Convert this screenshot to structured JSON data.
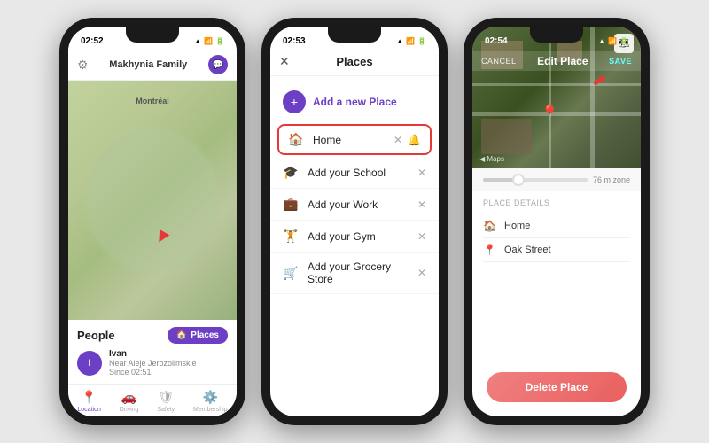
{
  "phone1": {
    "statusBar": {
      "time": "02:52",
      "icons": "▲ ▼ 📶 🔋"
    },
    "header": {
      "familyName": "Makhynia Family"
    },
    "mapLabel": "Montréal",
    "bottomPanel": {
      "peopleLabel": "People",
      "placesBtn": "Places",
      "person": {
        "initial": "I",
        "name": "Ivan",
        "location": "Near Aleje Jerozolimskie",
        "since": "Since 02:51"
      }
    },
    "nav": [
      {
        "label": "Location",
        "icon": "📍",
        "active": true
      },
      {
        "label": "Driving",
        "icon": "🚗",
        "active": false
      },
      {
        "label": "Safety",
        "icon": "🛡",
        "active": false
      },
      {
        "label": "Membership",
        "icon": "⚙️",
        "active": false
      }
    ]
  },
  "phone2": {
    "statusBar": {
      "time": "02:53"
    },
    "header": {
      "title": "Places"
    },
    "addNew": "Add a new Place",
    "places": [
      {
        "icon": "🏠",
        "name": "Home",
        "highlighted": true,
        "hasX": true,
        "hasBell": true
      },
      {
        "icon": "🎓",
        "name": "Add your School",
        "highlighted": false,
        "hasX": true,
        "hasBell": false
      },
      {
        "icon": "💼",
        "name": "Add your Work",
        "highlighted": false,
        "hasX": true,
        "hasBell": false
      },
      {
        "icon": "🏋",
        "name": "Add your Gym",
        "highlighted": false,
        "hasX": true,
        "hasBell": false
      },
      {
        "icon": "🛒",
        "name": "Add your Grocery Store",
        "highlighted": false,
        "hasX": true,
        "hasBell": false
      }
    ]
  },
  "phone3": {
    "statusBar": {
      "time": "02:54"
    },
    "header": {
      "cancelLabel": "CANCEL",
      "title": "Edit Place",
      "saveLabel": "SAVE"
    },
    "radiusLabel": "76 m zone",
    "placeDetailsTitle": "Place details",
    "placeDetails": [
      {
        "icon": "🏠",
        "value": "Home"
      },
      {
        "icon": "📍",
        "value": "Oak Street"
      }
    ],
    "deleteBtnLabel": "Delete Place",
    "mapsLabel": "◀ Maps"
  }
}
